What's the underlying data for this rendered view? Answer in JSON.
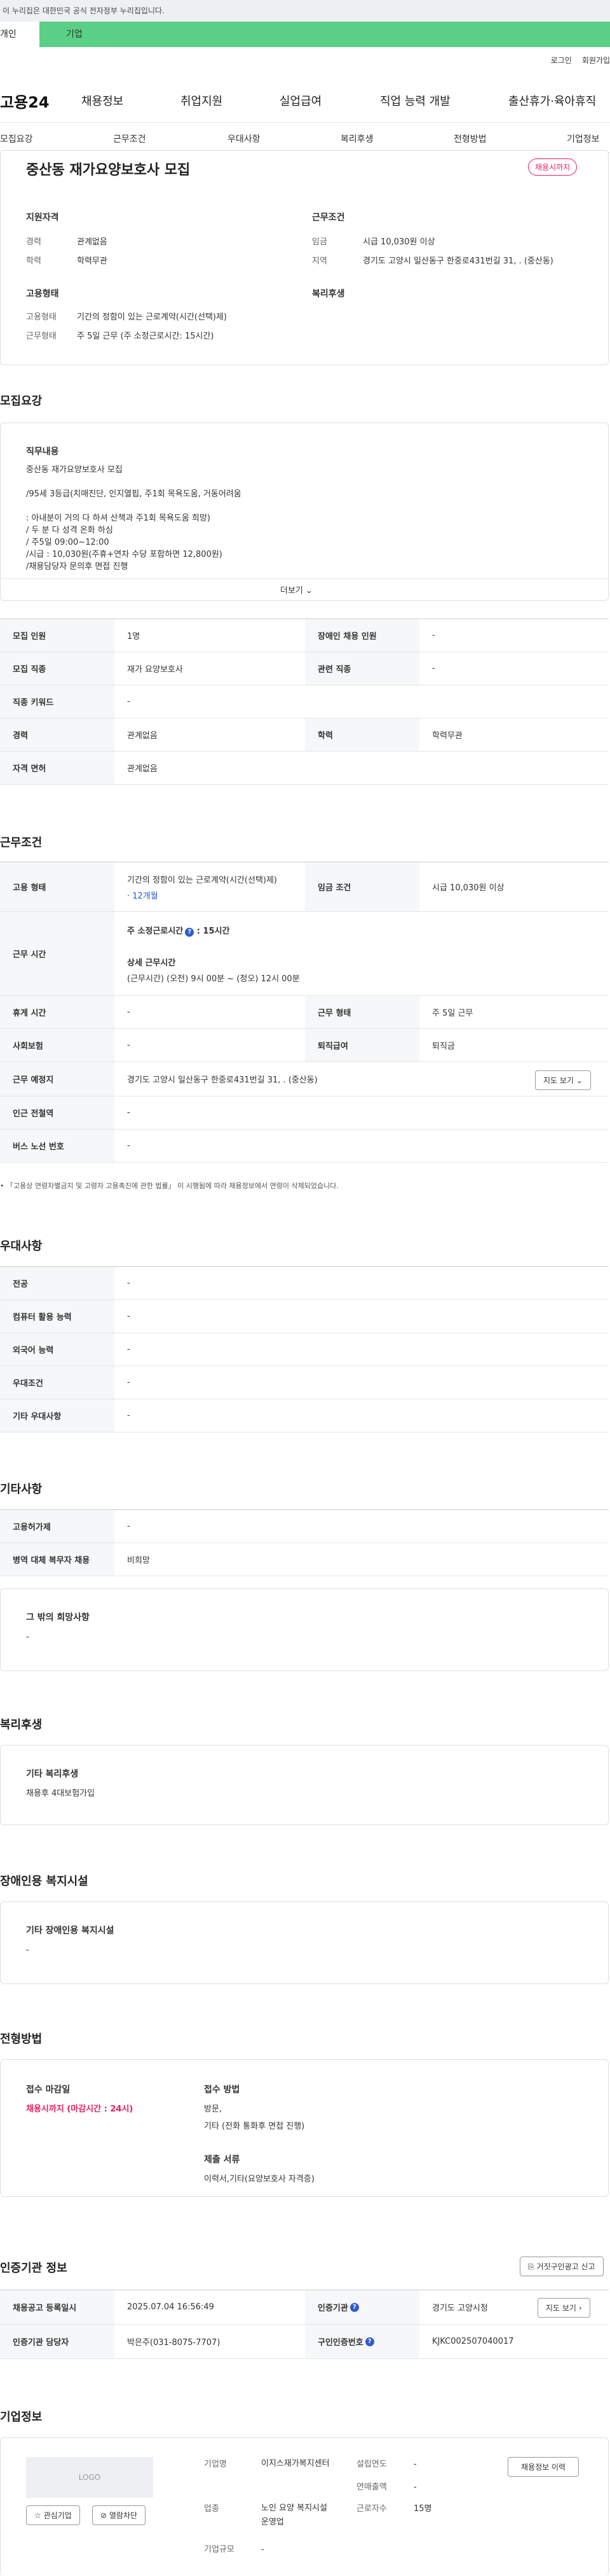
{
  "notice": "이 누리집은 대한민국 공식 전자정부 누리집입니다.",
  "usertabs": {
    "personal": "개인",
    "company": "기업"
  },
  "top_links": {
    "login": "로그인",
    "join": "회원가입"
  },
  "logo": "고용24",
  "gnb": [
    "채용정보",
    "취업지원",
    "실업급여",
    "직업 능력 개발",
    "출산휴가·육아휴직"
  ],
  "subnav": [
    "모집요강",
    "근무조건",
    "우대사항",
    "복리후생",
    "전형방법",
    "기업정보"
  ],
  "job": {
    "title": "중산동 재가요양보호사 모집",
    "status": "채용시까지",
    "qual_title": "지원자격",
    "career_k": "경력",
    "career_v": "관계없음",
    "edu_k": "학력",
    "edu_v": "학력무관",
    "cond_title": "근무조건",
    "wage_k": "임금",
    "wage_v": "시급 10,030원 이상",
    "region_k": "지역",
    "region_v": "경기도 고양시 일산동구 한중로431번길 31, . (중산동)",
    "emp_title": "고용형태",
    "emptype_k": "고용형태",
    "emptype_v": "기간의 정함이 있는 근로계약(시간(선택)제)",
    "worktype_k": "근무형태",
    "worktype_v": "주 5일 근무 (주 소정근로시간: 15시간)",
    "welfare_title": "복리후생"
  },
  "recruit": {
    "section": "모집요강",
    "duty_title": "직무내용",
    "duty_lines": [
      "중산동  재가요양보호사 모집",
      "",
      "/95세 3등급(치매진단, 인지열핍, 주1회 목욕도움, 거동어려움",
      "",
      ": 아내분이 거의 다 하셔 산책과 주1회 목욕도움 희망)",
      "/ 두 분 다 성격 온화 하심",
      "/ 주5일 09:00~12:00",
      "/시급 : 10,030원(주휴+연차 수당 포함하면 12,800원)",
      "/채용담당자 문의후 면접 진행"
    ],
    "more": "더보기",
    "rows": [
      {
        "k1": "모집 인원",
        "v1": "1명",
        "k2": "장애인 채용 인원",
        "v2": "-"
      },
      {
        "k1": "모집 직종",
        "v1": "재가 요양보호사",
        "k2": "관련 직종",
        "v2": "-"
      },
      {
        "k1": "직종 키워드",
        "v1": "-"
      },
      {
        "k1": "경력",
        "v1": "관계없음",
        "k2": "학력",
        "v2": "학력무관"
      },
      {
        "k1": "자격 면허",
        "v1": "관계없음"
      }
    ]
  },
  "work": {
    "section": "근무조건",
    "emp_k": "고용 형태",
    "emp_v": "기간의 정함이 있는 근로계약(시간(선택)제)",
    "emp_sub": "· 12개월",
    "wage_k": "임금 조건",
    "wage_v": "시급 10,030원 이상",
    "hours_k": "근무 시간",
    "hours_weekly": "주 소정근로시간",
    "hours_weekly_v": ": 15시간",
    "hours_detail_title": "상세 근무시간",
    "hours_detail": "(근무시간) (오전) 9시 00분 ~ (정오) 12시 00분",
    "rest_k": "휴게 시간",
    "rest_v": "-",
    "form_k": "근무 형태",
    "form_v": "주 5일 근무",
    "ins_k": "사회보험",
    "ins_v": "-",
    "sev_k": "퇴직급여",
    "sev_v": "퇴직금",
    "place_k": "근무 예정지",
    "place_v": "경기도 고양시 일산동구 한중로431번길 31, . (중산동)",
    "map_btn": "지도 보기",
    "station_k": "인근 전철역",
    "station_v": "-",
    "bus_k": "버스 노선 번호",
    "bus_v": "-",
    "footnote": "「고용상 연령차별금지 및 고령자 고용촉진에 관한 법률」 이 시행됨에 따라 채용정보에서 연령이 삭제되었습니다."
  },
  "pref": {
    "section": "우대사항",
    "rows": [
      {
        "k": "전공",
        "v": "-"
      },
      {
        "k": "컴퓨터 활용 능력",
        "v": "-"
      },
      {
        "k": "외국어 능력",
        "v": "-"
      },
      {
        "k": "우대조건",
        "v": "-"
      },
      {
        "k": "기타 우대사항",
        "v": "-"
      }
    ]
  },
  "etc": {
    "section": "기타사항",
    "rows": [
      {
        "k": "고용허가제",
        "v": "-"
      },
      {
        "k": "병역 대체 복무자 채용",
        "v": "비희망"
      }
    ],
    "other_title": "그 밖의 희망사항",
    "other_v": "-"
  },
  "welfare": {
    "section": "복리후생",
    "title": "기타 복리후생",
    "value": "채용후 4대보험가입"
  },
  "disab": {
    "section": "장애인용 복지시설",
    "title": "기타 장애인용 복지시설",
    "value": "-"
  },
  "process": {
    "section": "전형방법",
    "deadline_title": "접수 마감일",
    "deadline_v": "채용시까지 (마감시간 : 24시)",
    "method_title": "접수 방법",
    "method_v1": "방문,",
    "method_v2": "기타 (전화 통화후 면접 진행)",
    "docs_title": "제출 서류",
    "docs_v": "이력서,기타(요양보호사 자격증)"
  },
  "auth": {
    "section": "인증기관 정보",
    "report_btn": "거짓구인광고 신고",
    "reg_k": "채용공고 등록일시",
    "reg_v": "2025.07.04 16:56:49",
    "org_k": "인증기관",
    "org_v": "경기도 고양시청",
    "map_btn": "지도 보기",
    "mgr_k": "인증기관 담당자",
    "mgr_v": "박은주(031-8075-7707)",
    "no_k": "구인인증번호",
    "no_v": "KJKC002507040017"
  },
  "company": {
    "section": "기업정보",
    "logo": "LOGO",
    "fav_btn": "관심기업",
    "block_btn": "열람차단",
    "name_k": "기업명",
    "name_v": "이지스재가복지센터",
    "est_k": "설립연도",
    "est_v": "-",
    "sales_k": "연매출액",
    "sales_v": "-",
    "biz_k": "업종",
    "biz_v": "노인 요양 복지시설 운영업",
    "emp_k": "근로자수",
    "emp_v": "15명",
    "size_k": "기업규모",
    "size_v": "-",
    "history_btn": "채용정보 이력"
  }
}
